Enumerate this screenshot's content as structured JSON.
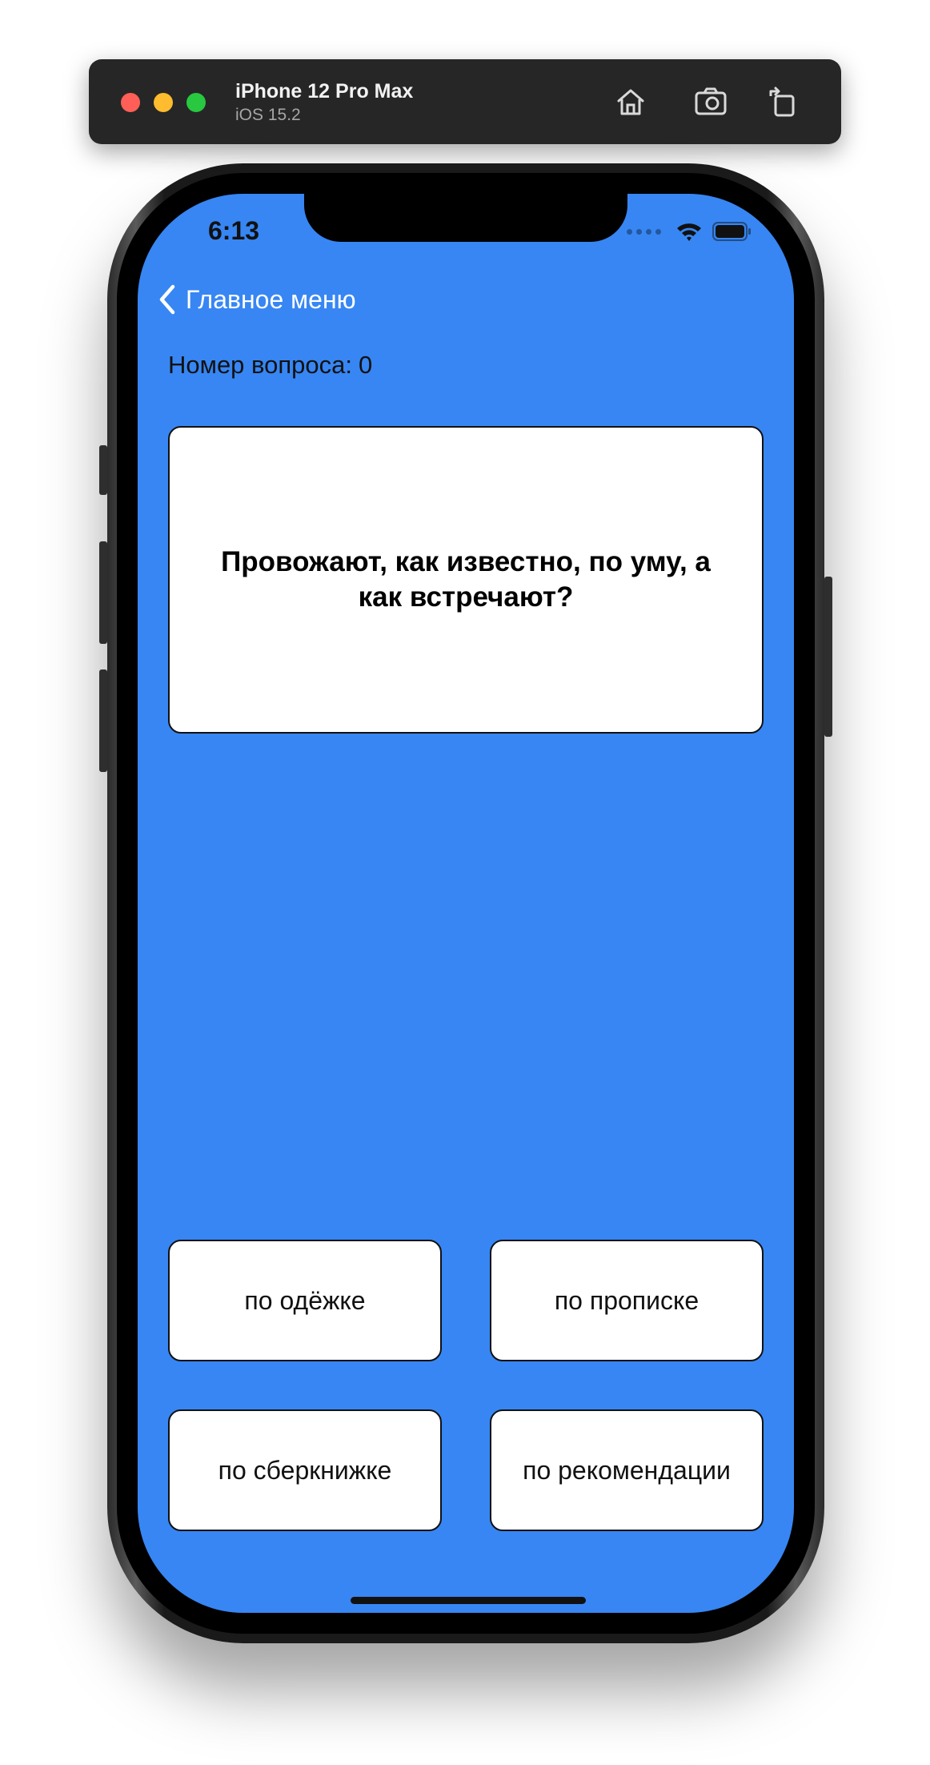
{
  "simulator": {
    "device_name": "iPhone 12 Pro Max",
    "os_version": "iOS 15.2",
    "icons": [
      "home-icon",
      "screenshot-icon",
      "rotate-icon"
    ]
  },
  "status_bar": {
    "time": "6:13",
    "icons": [
      "cellular-dots-icon",
      "wifi-icon",
      "battery-icon"
    ]
  },
  "nav": {
    "back_label": "Главное меню",
    "back_icon": "chevron-left-icon"
  },
  "quiz": {
    "question_number_label": "Номер вопроса:",
    "question_number": "0",
    "question_text": "Провожают, как известно, по уму, а как встречают?",
    "answers": [
      "по одёжке",
      "по прописке",
      "по сберкнижке",
      "по рекомендации"
    ]
  },
  "colors": {
    "screen_background": "#3786f3",
    "card_background": "#ffffff",
    "nav_text": "#ffffff"
  }
}
